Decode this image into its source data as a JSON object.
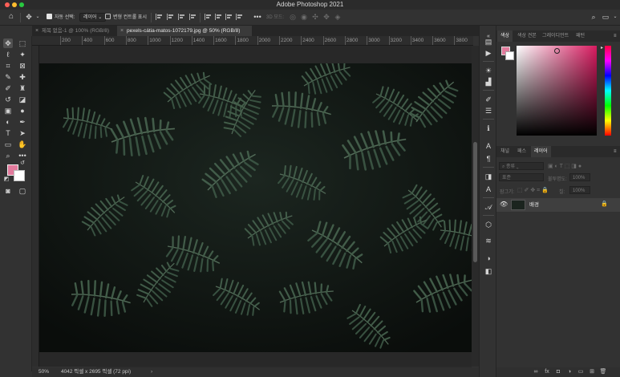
{
  "window": {
    "title": "Adobe Photoshop 2021"
  },
  "options_bar": {
    "auto_select_label": "자동 선택:",
    "auto_select_target": "레이어",
    "transform_controls_label": "변형 컨트롤 표시",
    "mode_3d_label": "3D 모드:"
  },
  "tabs": [
    {
      "label": "제목 없음-1 @ 100% (RGB/8)",
      "active": false
    },
    {
      "label": "pexels-cátia-matos-1072179.jpg @ 50% (RGB/8)",
      "active": true
    }
  ],
  "ruler": {
    "ticks": [
      "200",
      "400",
      "600",
      "800",
      "1000",
      "1200",
      "1400",
      "1600",
      "1800",
      "2000",
      "2200",
      "2400",
      "2600",
      "2800",
      "3000",
      "3200",
      "3400",
      "3600",
      "3800"
    ]
  },
  "status": {
    "zoom": "50%",
    "info": "4042 픽셀 x 2695 픽셀 (72 ppi)",
    "arrow": "›"
  },
  "color_panel": {
    "tabs": [
      "색상",
      "색상 견본",
      "그레이디언트",
      "패턴"
    ],
    "active_tab": "색상",
    "foreground_color": "#e27a9c",
    "background_color": "#ffffff"
  },
  "layers_panel": {
    "tabs": [
      "채널",
      "패스",
      "레이어"
    ],
    "active_tab": "레이어",
    "filter_placeholder": "종류",
    "blend_mode": "표준",
    "opacity_label": "불투명도:",
    "opacity_value": "100%",
    "lock_label": "잠그기:",
    "fill_label": "칠:",
    "fill_value": "100%",
    "layers": [
      {
        "name": "배경",
        "visible": true,
        "locked": true
      }
    ]
  }
}
